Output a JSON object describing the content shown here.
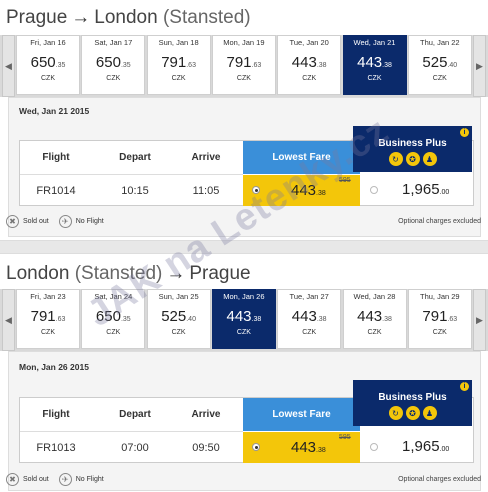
{
  "legend": {
    "sold_out": "Sold out",
    "no_flight": "No Flight"
  },
  "optional": "Optional charges excluded",
  "headers": {
    "flight": "Flight",
    "depart": "Depart",
    "arrive": "Arrive",
    "lowest": "Lowest Fare",
    "business": "Business Plus",
    "info": "i"
  },
  "watermark": "JAK na Letenky.cz",
  "out": {
    "route": {
      "from": "Prague",
      "arrow": "→",
      "to": "London",
      "airport": "(Stansted)"
    },
    "days": [
      {
        "date": "Fri, Jan 16",
        "int": "650",
        "dec": ".35",
        "cur": "CZK"
      },
      {
        "date": "Sat, Jan 17",
        "int": "650",
        "dec": ".35",
        "cur": "CZK"
      },
      {
        "date": "Sun, Jan 18",
        "int": "791",
        "dec": ".63",
        "cur": "CZK"
      },
      {
        "date": "Mon, Jan 19",
        "int": "791",
        "dec": ".63",
        "cur": "CZK"
      },
      {
        "date": "Tue, Jan 20",
        "int": "443",
        "dec": ".38",
        "cur": "CZK"
      },
      {
        "date": "Wed, Jan 21",
        "int": "443",
        "dec": ".38",
        "cur": "CZK"
      },
      {
        "date": "Thu, Jan 22",
        "int": "525",
        "dec": ".40",
        "cur": "CZK"
      }
    ],
    "selected_index": 5,
    "selected_date": "Wed, Jan 21 2015",
    "flight": {
      "num": "FR1014",
      "depart": "10:15",
      "arrive": "11:05",
      "lf_int": "443",
      "lf_dec": ".38",
      "lf_old": "595",
      "bp_int": "1,965",
      "bp_dec": ".00"
    }
  },
  "ret": {
    "route": {
      "from": "London",
      "airport": "(Stansted)",
      "arrow": "→",
      "to": "Prague"
    },
    "days": [
      {
        "date": "Fri, Jan 23",
        "int": "791",
        "dec": ".63",
        "cur": "CZK"
      },
      {
        "date": "Sat, Jan 24",
        "int": "650",
        "dec": ".35",
        "cur": "CZK"
      },
      {
        "date": "Sun, Jan 25",
        "int": "525",
        "dec": ".40",
        "cur": "CZK"
      },
      {
        "date": "Mon, Jan 26",
        "int": "443",
        "dec": ".38",
        "cur": "CZK"
      },
      {
        "date": "Tue, Jan 27",
        "int": "443",
        "dec": ".38",
        "cur": "CZK"
      },
      {
        "date": "Wed, Jan 28",
        "int": "443",
        "dec": ".38",
        "cur": "CZK"
      },
      {
        "date": "Thu, Jan 29",
        "int": "791",
        "dec": ".63",
        "cur": "CZK"
      }
    ],
    "selected_index": 3,
    "selected_date": "Mon, Jan 26 2015",
    "flight": {
      "num": "FR1013",
      "depart": "07:00",
      "arrive": "09:50",
      "lf_int": "443",
      "lf_dec": ".38",
      "lf_old": "595",
      "bp_int": "1,965",
      "bp_dec": ".00"
    }
  }
}
